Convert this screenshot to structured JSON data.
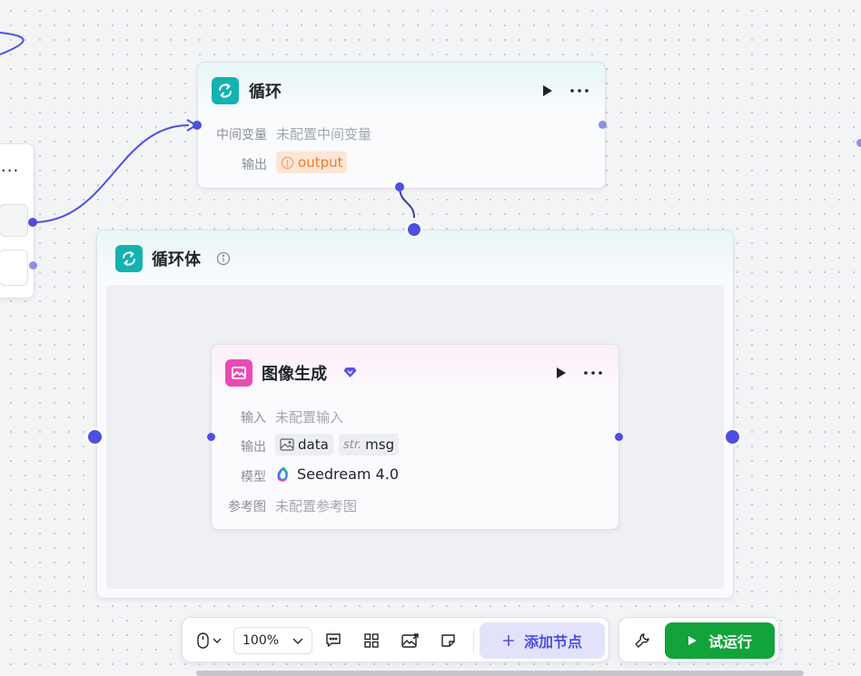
{
  "loop_node": {
    "title": "循环",
    "rows": [
      {
        "label": "中间变量",
        "value": "未配置中间变量"
      },
      {
        "label": "输出",
        "value": "output"
      }
    ]
  },
  "loop_body": {
    "title": "循环体"
  },
  "image_node": {
    "title": "图像生成",
    "rows": [
      {
        "label": "输入",
        "value": "未配置输入"
      },
      {
        "label": "输出"
      },
      {
        "label": "模型",
        "value": "Seedream 4.0"
      },
      {
        "label": "参考图",
        "value": "未配置参考图"
      }
    ],
    "outputs": [
      {
        "type": "",
        "name": "data"
      },
      {
        "type": "str.",
        "name": "msg"
      }
    ]
  },
  "toolbar": {
    "zoom": "100%",
    "add_node_label": "添加节点",
    "test_run_label": "试运行"
  },
  "left_node": {
    "more": "..."
  },
  "colors": {
    "accent": "#4e4fe0",
    "loop_icon": "#12b3b0",
    "image_icon": "#e94bb5",
    "run_green": "#12a33a",
    "warning_orange": "#f07a2c"
  }
}
